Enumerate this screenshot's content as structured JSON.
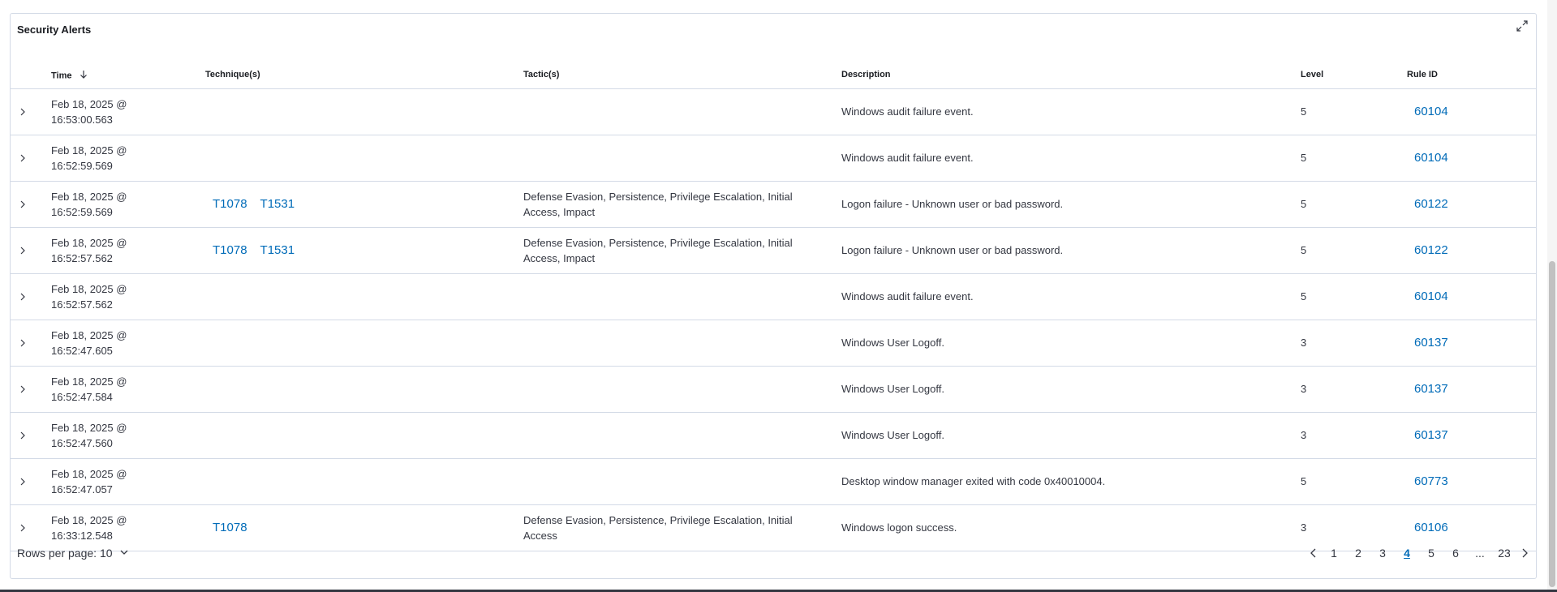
{
  "panel": {
    "title": "Security Alerts",
    "expand_icon": "expand-icon"
  },
  "columns": {
    "time": "Time",
    "techniques": "Technique(s)",
    "tactics": "Tactic(s)",
    "description": "Description",
    "level": "Level",
    "rule_id": "Rule ID"
  },
  "rows": [
    {
      "time_line1": "Feb 18, 2025 @",
      "time_line2": "16:53:00.563",
      "techniques": [],
      "tactics": "",
      "description": "Windows audit failure event.",
      "level": "5",
      "rule_id": "60104"
    },
    {
      "time_line1": "Feb 18, 2025 @",
      "time_line2": "16:52:59.569",
      "techniques": [],
      "tactics": "",
      "description": "Windows audit failure event.",
      "level": "5",
      "rule_id": "60104"
    },
    {
      "time_line1": "Feb 18, 2025 @",
      "time_line2": "16:52:59.569",
      "techniques": [
        "T1078",
        "T1531"
      ],
      "tactics": "Defense Evasion, Persistence, Privilege Escalation, Initial Access, Impact",
      "description": "Logon failure - Unknown user or bad password.",
      "level": "5",
      "rule_id": "60122"
    },
    {
      "time_line1": "Feb 18, 2025 @",
      "time_line2": "16:52:57.562",
      "techniques": [
        "T1078",
        "T1531"
      ],
      "tactics": "Defense Evasion, Persistence, Privilege Escalation, Initial Access, Impact",
      "description": "Logon failure - Unknown user or bad password.",
      "level": "5",
      "rule_id": "60122"
    },
    {
      "time_line1": "Feb 18, 2025 @",
      "time_line2": "16:52:57.562",
      "techniques": [],
      "tactics": "",
      "description": "Windows audit failure event.",
      "level": "5",
      "rule_id": "60104"
    },
    {
      "time_line1": "Feb 18, 2025 @",
      "time_line2": "16:52:47.605",
      "techniques": [],
      "tactics": "",
      "description": "Windows User Logoff.",
      "level": "3",
      "rule_id": "60137"
    },
    {
      "time_line1": "Feb 18, 2025 @",
      "time_line2": "16:52:47.584",
      "techniques": [],
      "tactics": "",
      "description": "Windows User Logoff.",
      "level": "3",
      "rule_id": "60137"
    },
    {
      "time_line1": "Feb 18, 2025 @",
      "time_line2": "16:52:47.560",
      "techniques": [],
      "tactics": "",
      "description": "Windows User Logoff.",
      "level": "3",
      "rule_id": "60137"
    },
    {
      "time_line1": "Feb 18, 2025 @",
      "time_line2": "16:52:47.057",
      "techniques": [],
      "tactics": "",
      "description": "Desktop window manager exited with code 0x40010004.",
      "level": "5",
      "rule_id": "60773"
    },
    {
      "time_line1": "Feb 18, 2025 @",
      "time_line2": "16:33:12.548",
      "techniques": [
        "T1078"
      ],
      "tactics": "Defense Evasion, Persistence, Privilege Escalation, Initial Access",
      "description": "Windows logon success.",
      "level": "3",
      "rule_id": "60106"
    }
  ],
  "footer": {
    "rows_per_page_label": "Rows per page: 10",
    "pages": [
      "1",
      "2",
      "3",
      "4",
      "5",
      "6",
      "...",
      "23"
    ],
    "active_page": "4"
  },
  "colors": {
    "link": "#006bb8",
    "border": "#d3dae6",
    "text": "#343741"
  }
}
